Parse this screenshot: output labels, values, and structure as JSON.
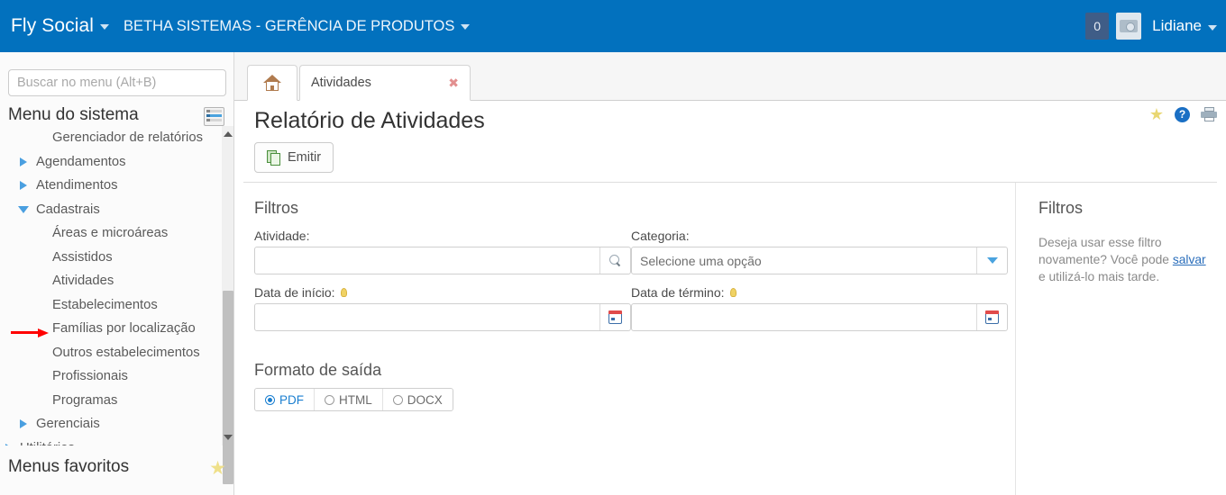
{
  "header": {
    "brand": "Fly Social",
    "organization": "BETHA SISTEMAS - GERÊNCIA DE PRODUTOS",
    "notification_count": "0",
    "user_name": "Lidiane",
    "background_color": "#0271be"
  },
  "sidebar": {
    "search_placeholder": "Buscar no menu (Alt+B)",
    "search_value": "",
    "system_menu_title": "Menu do sistema",
    "favorites_title": "Menus favoritos",
    "items": [
      {
        "label": "Gerenciador de relatórios",
        "level": 1,
        "arrow": "none"
      },
      {
        "label": "Agendamentos",
        "level": 0,
        "arrow": "collapsed"
      },
      {
        "label": "Atendimentos",
        "level": 0,
        "arrow": "collapsed"
      },
      {
        "label": "Cadastrais",
        "level": 0,
        "arrow": "expanded"
      },
      {
        "label": "Áreas e microáreas",
        "level": 1,
        "arrow": "none"
      },
      {
        "label": "Assistidos",
        "level": 1,
        "arrow": "none"
      },
      {
        "label": "Atividades",
        "level": 1,
        "arrow": "none"
      },
      {
        "label": "Estabelecimentos",
        "level": 1,
        "arrow": "none"
      },
      {
        "label": "Famílias por localização",
        "level": 1,
        "arrow": "none"
      },
      {
        "label": "Outros estabelecimentos",
        "level": 1,
        "arrow": "none"
      },
      {
        "label": "Profissionais",
        "level": 1,
        "arrow": "none"
      },
      {
        "label": "Programas",
        "level": 1,
        "arrow": "none"
      },
      {
        "label": "Gerenciais",
        "level": 0,
        "arrow": "collapsed"
      },
      {
        "label": "Utilitários",
        "level": -1,
        "arrow": "collapsed"
      }
    ]
  },
  "tabs": [
    {
      "label": "",
      "icon": "home-icon",
      "closable": false
    },
    {
      "label": "Atividades",
      "icon": "",
      "closable": true,
      "close_glyph": "✖"
    }
  ],
  "page": {
    "title": "Relatório de Atividades",
    "emit_button_label": "Emitir",
    "help_glyph": "?"
  },
  "filters": {
    "heading": "Filtros",
    "activity_label": "Atividade:",
    "activity_value": "",
    "category_label": "Categoria:",
    "category_placeholder": "Selecione uma opção",
    "category_value": "",
    "start_date_label": "Data de início:",
    "start_date_value": "",
    "end_date_label": "Data de término:",
    "end_date_value": ""
  },
  "output": {
    "heading": "Formato de saída",
    "options": [
      {
        "label": "PDF",
        "selected": true
      },
      {
        "label": "HTML",
        "selected": false
      },
      {
        "label": "DOCX",
        "selected": false
      }
    ]
  },
  "help_panel": {
    "title": "Filtros",
    "text_before": "Deseja usar esse filtro novamente? Você pode ",
    "link": "salvar",
    "text_after": " e utilizá-lo mais tarde."
  }
}
